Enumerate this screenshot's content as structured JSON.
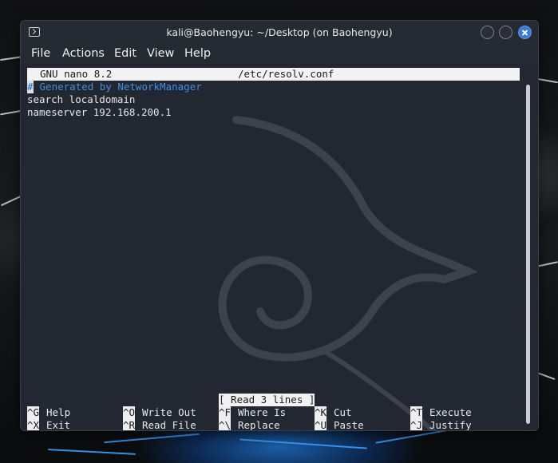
{
  "window": {
    "title": "kali@Baohengyu: ~/Desktop (on Baohengyu)"
  },
  "menu": {
    "items": [
      "File",
      "Actions",
      "Edit",
      "View",
      "Help"
    ]
  },
  "nano": {
    "version": "GNU nano 8.2",
    "filename": "/etc/resolv.conf",
    "lines": [
      {
        "prefix": "#",
        "text": " Generated by NetworkManager"
      },
      {
        "text": "search localdomain"
      },
      {
        "text": "nameserver 192.168.200.1"
      }
    ],
    "status": "[ Read 3 lines ]",
    "shortcuts_row1": [
      {
        "key": "^G",
        "label": "Help"
      },
      {
        "key": "^O",
        "label": "Write Out"
      },
      {
        "key": "^F",
        "label": "Where Is"
      },
      {
        "key": "^K",
        "label": "Cut"
      },
      {
        "key": "^T",
        "label": "Execute"
      }
    ],
    "shortcuts_row2": [
      {
        "key": "^X",
        "label": "Exit"
      },
      {
        "key": "^R",
        "label": "Read File"
      },
      {
        "key": "^\\",
        "label": "Replace"
      },
      {
        "key": "^U",
        "label": "Paste"
      },
      {
        "key": "^J",
        "label": "Justify"
      }
    ]
  },
  "icons": {
    "terminal": "terminal-icon",
    "minimize": "minimize-icon",
    "maximize": "maximize-icon",
    "close": "close-icon"
  },
  "colors": {
    "window_bg": "#232731",
    "comment": "#3d8fe0",
    "close_button": "#3a7bd5"
  }
}
